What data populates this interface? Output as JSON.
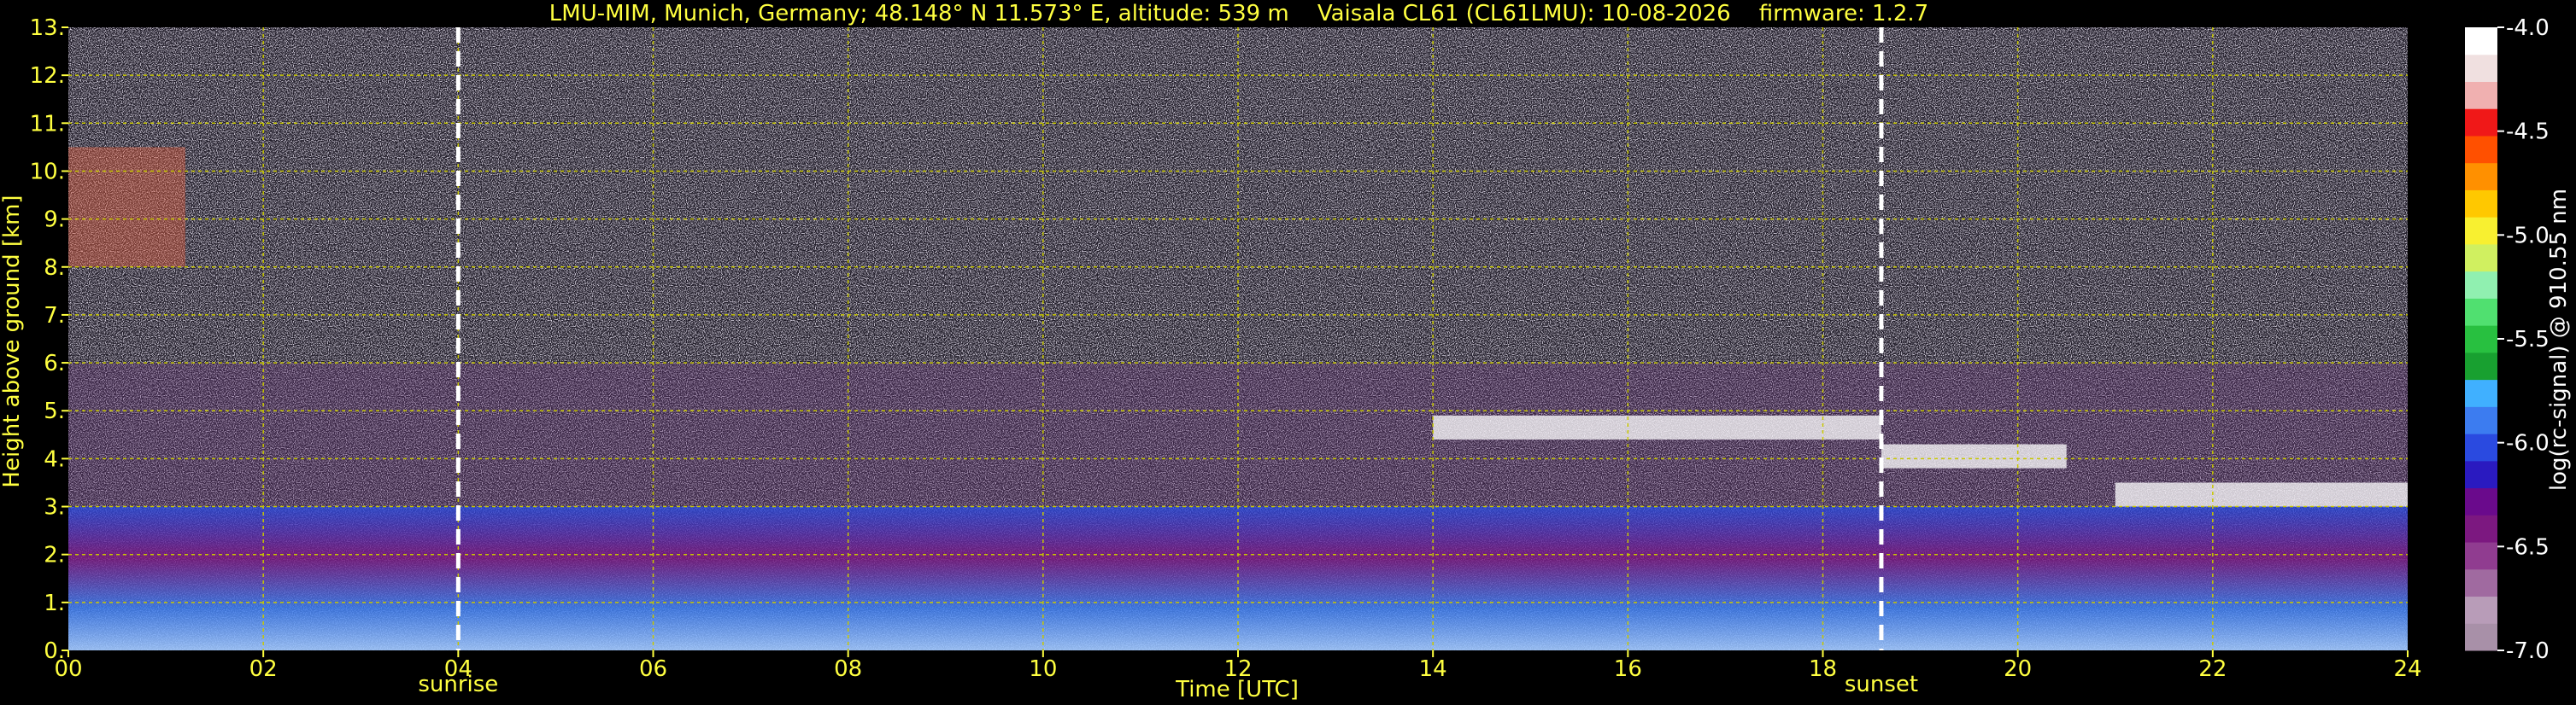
{
  "chart_data": {
    "type": "heatmap",
    "title": "LMU-MIM, Munich, Germany; 48.148° N 11.573° E, altitude: 539 m    Vaisala CL61 (CL61LMU): 10-08-2026    firmware: 1.2.7",
    "xlabel": "Time [UTC]",
    "ylabel": "Height above ground [km]",
    "xlim": [
      0,
      24
    ],
    "ylim": [
      0,
      13
    ],
    "x_ticks": [
      "00",
      "02",
      "04",
      "06",
      "08",
      "10",
      "12",
      "14",
      "16",
      "18",
      "20",
      "22",
      "24"
    ],
    "x_tick_values": [
      0,
      2,
      4,
      6,
      8,
      10,
      12,
      14,
      16,
      18,
      20,
      22,
      24
    ],
    "y_ticks": [
      "0.",
      "1.",
      "2.",
      "3.",
      "4.",
      "5.",
      "6.",
      "7.",
      "8.",
      "9.",
      "10.",
      "11.",
      "12.",
      "13."
    ],
    "y_tick_values": [
      0,
      1,
      2,
      3,
      4,
      5,
      6,
      7,
      8,
      9,
      10,
      11,
      12,
      13
    ],
    "grid": true,
    "markers": [
      {
        "label": "sunrise",
        "time": 4.0
      },
      {
        "label": "sunset",
        "time": 18.6
      }
    ],
    "colorbar": {
      "label": "log(rc-signal) @ 910.55 nm",
      "range": [
        -7.0,
        -4.0
      ],
      "ticks": [
        "-4.0",
        "-4.5",
        "-5.0",
        "-5.5",
        "-6.0",
        "-6.5",
        "-7.0"
      ],
      "tick_values": [
        -4.0,
        -4.5,
        -5.0,
        -5.5,
        -6.0,
        -6.5,
        -7.0
      ],
      "colors": [
        "#a890a8",
        "#b89cb8",
        "#a06aa0",
        "#903c90",
        "#7c1880",
        "#6a0a8c",
        "#2a1ac0",
        "#2a4ae0",
        "#3c7cf0",
        "#40b0ff",
        "#18a030",
        "#28c040",
        "#50e070",
        "#90f0b0",
        "#d0f060",
        "#f8f030",
        "#ffc800",
        "#ff9000",
        "#ff5000",
        "#f01818",
        "#f0b0b0",
        "#f0e0e0",
        "#ffffff"
      ]
    },
    "features": [
      {
        "name": "boundary layer aerosol",
        "t_start": 0,
        "t_end": 24,
        "z_bottom": 0,
        "z_top": 3
      },
      {
        "name": "cloud layer",
        "t_start": 14,
        "t_end": 18.6,
        "z_bottom": 4.4,
        "z_top": 4.9
      },
      {
        "name": "cloud layer",
        "t_start": 18.6,
        "t_end": 20.5,
        "z_bottom": 3.8,
        "z_top": 4.3
      },
      {
        "name": "cloud layer",
        "t_start": 21,
        "t_end": 24,
        "z_bottom": 3.0,
        "z_top": 3.5
      },
      {
        "name": "cirrus",
        "t_start": 0,
        "t_end": 1.2,
        "z_bottom": 8.0,
        "z_top": 10.5
      }
    ]
  }
}
